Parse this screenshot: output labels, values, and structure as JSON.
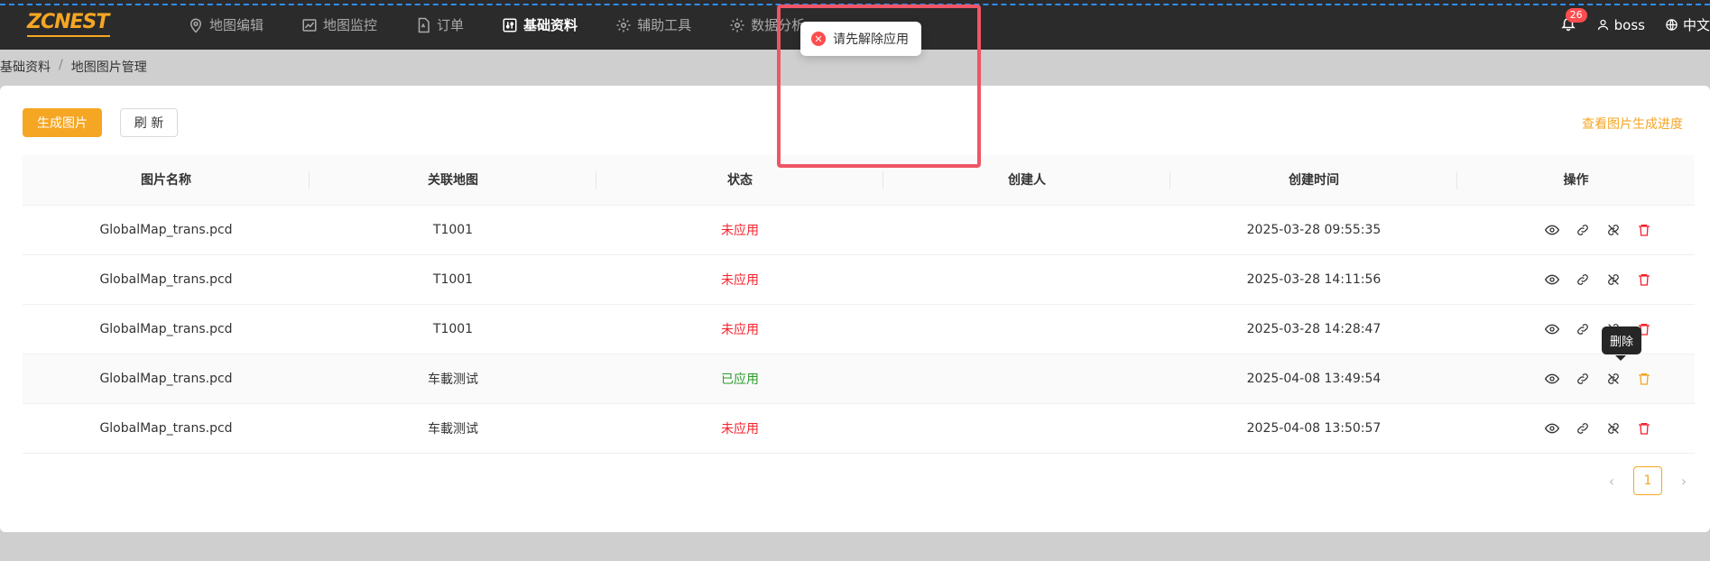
{
  "header": {
    "logo_text": "ZCNEST",
    "nav": [
      {
        "label": "地图编辑",
        "icon": "map-pin-icon"
      },
      {
        "label": "地图监控",
        "icon": "chart-icon"
      },
      {
        "label": "订单",
        "icon": "document-icon"
      },
      {
        "label": "基础资料",
        "icon": "sliders-icon"
      },
      {
        "label": "辅助工具",
        "icon": "gear-icon"
      },
      {
        "label": "数据分析",
        "icon": "gear-icon"
      }
    ],
    "active_nav": 3,
    "notification_count": "26",
    "user_name": "boss",
    "language": "中文"
  },
  "breadcrumb": {
    "items": [
      "基础资料",
      "地图图片管理"
    ]
  },
  "toolbar": {
    "generate_label": "生成图片",
    "refresh_label": "刷 新",
    "progress_link": "查看图片生成进度"
  },
  "table": {
    "columns": [
      "图片名称",
      "关联地图",
      "状态",
      "创建人",
      "创建时间",
      "操作"
    ],
    "rows": [
      {
        "name": "GlobalMap_trans.pcd",
        "map": "T1001",
        "status": "未应用",
        "creator": "",
        "time": "2025-03-28 09:55:35"
      },
      {
        "name": "GlobalMap_trans.pcd",
        "map": "T1001",
        "status": "未应用",
        "creator": "",
        "time": "2025-03-28 14:11:56"
      },
      {
        "name": "GlobalMap_trans.pcd",
        "map": "T1001",
        "status": "未应用",
        "creator": "",
        "time": "2025-03-28 14:28:47"
      },
      {
        "name": "GlobalMap_trans.pcd",
        "map": "车載测试",
        "status": "已应用",
        "creator": "",
        "time": "2025-04-08 13:49:54"
      },
      {
        "name": "GlobalMap_trans.pcd",
        "map": "车載测试",
        "status": "未应用",
        "creator": "",
        "time": "2025-04-08 13:50:57"
      }
    ]
  },
  "pagination": {
    "current_page": "1"
  },
  "tooltip": {
    "text": "删除"
  },
  "toast": {
    "message": "请先解除应用"
  },
  "colors": {
    "accent": "#f5a623",
    "danger": "#f5222d",
    "success": "#2a9b2a",
    "header_bg": "#2b2b2b"
  }
}
